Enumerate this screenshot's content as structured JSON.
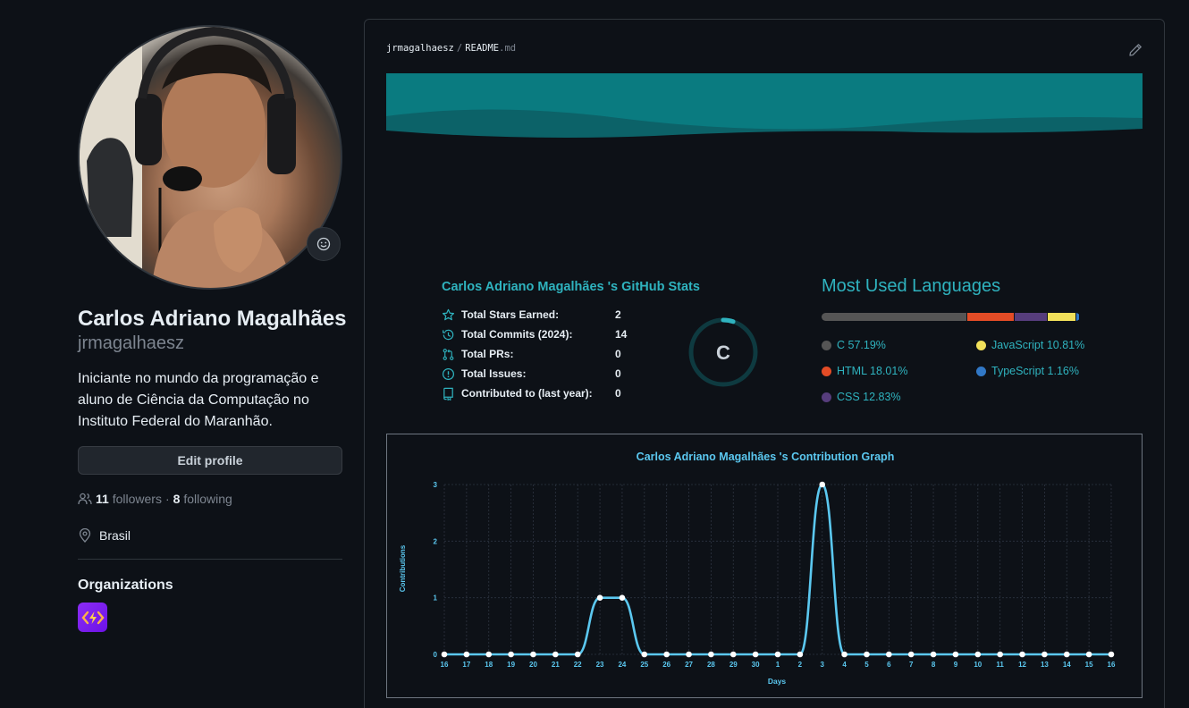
{
  "profile": {
    "full_name": "Carlos Adriano Magalhães",
    "login": "jrmagalhaesz",
    "bio": "Iniciante no mundo da programação e aluno de Ciência da Computação no Instituto Federal do Maranhão.",
    "edit_label": "Edit profile",
    "followers_count": "11",
    "followers_label": "followers",
    "separator": "·",
    "following_count": "8",
    "following_label": "following",
    "location": "Brasil",
    "organizations_title": "Organizations"
  },
  "readme": {
    "owner": "jrmagalhaesz",
    "path_sep": "/",
    "file": "README",
    "ext": ".md"
  },
  "stats": {
    "title": "Carlos Adriano Magalhães 's GitHub Stats",
    "rank": "C",
    "rank_progress": 0.05,
    "rows": [
      {
        "icon": "star-icon",
        "label": "Total Stars Earned:",
        "value": "2"
      },
      {
        "icon": "history-icon",
        "label": "Total Commits (2024):",
        "value": "14"
      },
      {
        "icon": "pull-request-icon",
        "label": "Total PRs:",
        "value": "0"
      },
      {
        "icon": "issue-icon",
        "label": "Total Issues:",
        "value": "0"
      },
      {
        "icon": "repo-icon",
        "label": "Contributed to (last year):",
        "value": "0"
      }
    ]
  },
  "languages": {
    "title": "Most Used Languages",
    "items": [
      {
        "name": "C",
        "percent": 57.19,
        "label": "C 57.19%",
        "color": "#555555"
      },
      {
        "name": "HTML",
        "percent": 18.01,
        "label": "HTML 18.01%",
        "color": "#e34c26"
      },
      {
        "name": "CSS",
        "percent": 12.83,
        "label": "CSS 12.83%",
        "color": "#563d7c"
      },
      {
        "name": "JavaScript",
        "percent": 10.81,
        "label": "JavaScript 10.81%",
        "color": "#f1e05a"
      },
      {
        "name": "TypeScript",
        "percent": 1.16,
        "label": "TypeScript 1.16%",
        "color": "#3178c6"
      }
    ]
  },
  "chart_data": {
    "type": "line",
    "title": "Carlos Adriano Magalhães 's Contribution Graph",
    "xlabel": "Days",
    "ylabel": "Contributions",
    "x": [
      "16",
      "17",
      "18",
      "19",
      "20",
      "21",
      "22",
      "23",
      "24",
      "25",
      "26",
      "27",
      "28",
      "29",
      "30",
      "1",
      "2",
      "3",
      "4",
      "5",
      "6",
      "7",
      "8",
      "9",
      "10",
      "11",
      "12",
      "13",
      "14",
      "15",
      "16"
    ],
    "values": [
      0,
      0,
      0,
      0,
      0,
      0,
      0,
      1,
      1,
      0,
      0,
      0,
      0,
      0,
      0,
      0,
      0,
      3,
      0,
      0,
      0,
      0,
      0,
      0,
      0,
      0,
      0,
      0,
      0,
      0,
      0
    ],
    "ylim": [
      0,
      3
    ],
    "yticks": [
      "0",
      "1",
      "2",
      "3"
    ],
    "grid": true,
    "colors": {
      "line": "#5bc8f0",
      "point": "#ffffff",
      "title": "#5bc8f0",
      "grid": "#2d3440"
    }
  }
}
